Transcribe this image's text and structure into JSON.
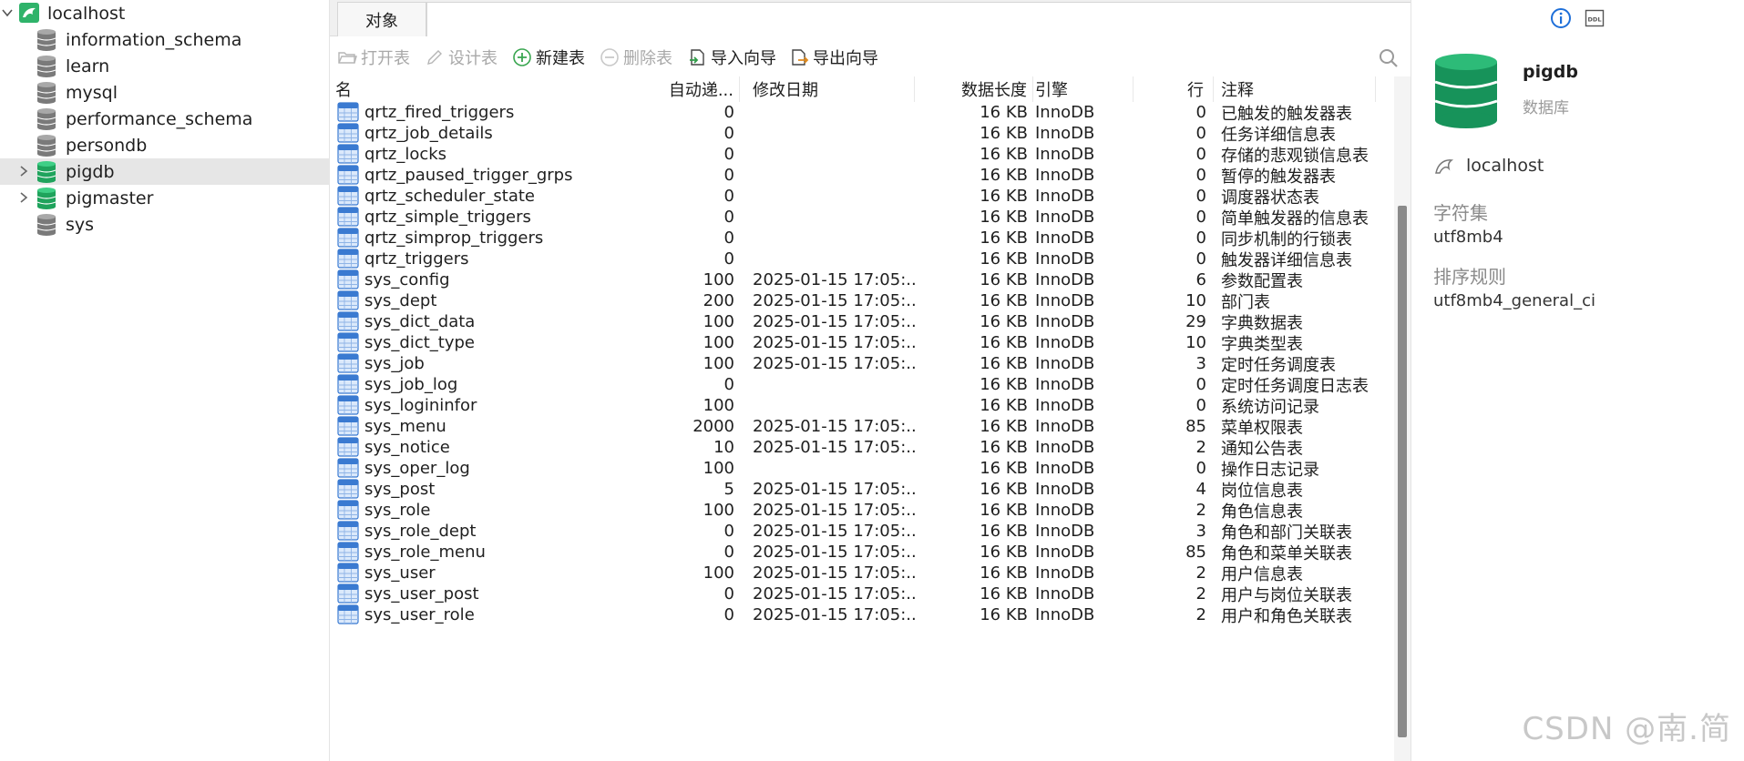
{
  "tree": {
    "connection": "localhost",
    "databases": [
      {
        "name": "information_schema",
        "active": false,
        "expandable": false
      },
      {
        "name": "learn",
        "active": false,
        "expandable": false
      },
      {
        "name": "mysql",
        "active": false,
        "expandable": false
      },
      {
        "name": "performance_schema",
        "active": false,
        "expandable": false
      },
      {
        "name": "persondb",
        "active": false,
        "expandable": false
      },
      {
        "name": "pigdb",
        "active": true,
        "expandable": true,
        "selected": true
      },
      {
        "name": "pigmaster",
        "active": true,
        "expandable": true
      },
      {
        "name": "sys",
        "active": false,
        "expandable": false
      }
    ]
  },
  "tabs": {
    "objects": "对象"
  },
  "toolbar": {
    "open_table": "打开表",
    "design_table": "设计表",
    "new_table": "新建表",
    "delete_table": "删除表",
    "import_wizard": "导入向导",
    "export_wizard": "导出向导"
  },
  "table_headers": {
    "name": "名",
    "auto_increment": "自动递...",
    "modified": "修改日期",
    "data_length": "数据长度",
    "engine": "引擎",
    "rows": "行",
    "comment": "注释"
  },
  "tables": [
    {
      "name": "qrtz_fired_triggers",
      "auto_inc": "0",
      "modified": "",
      "size": "16 KB",
      "engine": "InnoDB",
      "rows": "0",
      "comment": "已触发的触发器表"
    },
    {
      "name": "qrtz_job_details",
      "auto_inc": "0",
      "modified": "",
      "size": "16 KB",
      "engine": "InnoDB",
      "rows": "0",
      "comment": "任务详细信息表"
    },
    {
      "name": "qrtz_locks",
      "auto_inc": "0",
      "modified": "",
      "size": "16 KB",
      "engine": "InnoDB",
      "rows": "0",
      "comment": "存储的悲观锁信息表"
    },
    {
      "name": "qrtz_paused_trigger_grps",
      "auto_inc": "0",
      "modified": "",
      "size": "16 KB",
      "engine": "InnoDB",
      "rows": "0",
      "comment": "暂停的触发器表"
    },
    {
      "name": "qrtz_scheduler_state",
      "auto_inc": "0",
      "modified": "",
      "size": "16 KB",
      "engine": "InnoDB",
      "rows": "0",
      "comment": "调度器状态表"
    },
    {
      "name": "qrtz_simple_triggers",
      "auto_inc": "0",
      "modified": "",
      "size": "16 KB",
      "engine": "InnoDB",
      "rows": "0",
      "comment": "简单触发器的信息表"
    },
    {
      "name": "qrtz_simprop_triggers",
      "auto_inc": "0",
      "modified": "",
      "size": "16 KB",
      "engine": "InnoDB",
      "rows": "0",
      "comment": "同步机制的行锁表"
    },
    {
      "name": "qrtz_triggers",
      "auto_inc": "0",
      "modified": "",
      "size": "16 KB",
      "engine": "InnoDB",
      "rows": "0",
      "comment": "触发器详细信息表"
    },
    {
      "name": "sys_config",
      "auto_inc": "100",
      "modified": "2025-01-15 17:05:...",
      "size": "16 KB",
      "engine": "InnoDB",
      "rows": "6",
      "comment": "参数配置表"
    },
    {
      "name": "sys_dept",
      "auto_inc": "200",
      "modified": "2025-01-15 17:05:...",
      "size": "16 KB",
      "engine": "InnoDB",
      "rows": "10",
      "comment": "部门表"
    },
    {
      "name": "sys_dict_data",
      "auto_inc": "100",
      "modified": "2025-01-15 17:05:...",
      "size": "16 KB",
      "engine": "InnoDB",
      "rows": "29",
      "comment": "字典数据表"
    },
    {
      "name": "sys_dict_type",
      "auto_inc": "100",
      "modified": "2025-01-15 17:05:...",
      "size": "16 KB",
      "engine": "InnoDB",
      "rows": "10",
      "comment": "字典类型表"
    },
    {
      "name": "sys_job",
      "auto_inc": "100",
      "modified": "2025-01-15 17:05:...",
      "size": "16 KB",
      "engine": "InnoDB",
      "rows": "3",
      "comment": "定时任务调度表"
    },
    {
      "name": "sys_job_log",
      "auto_inc": "0",
      "modified": "",
      "size": "16 KB",
      "engine": "InnoDB",
      "rows": "0",
      "comment": "定时任务调度日志表"
    },
    {
      "name": "sys_logininfor",
      "auto_inc": "100",
      "modified": "",
      "size": "16 KB",
      "engine": "InnoDB",
      "rows": "0",
      "comment": "系统访问记录"
    },
    {
      "name": "sys_menu",
      "auto_inc": "2000",
      "modified": "2025-01-15 17:05:...",
      "size": "16 KB",
      "engine": "InnoDB",
      "rows": "85",
      "comment": "菜单权限表"
    },
    {
      "name": "sys_notice",
      "auto_inc": "10",
      "modified": "2025-01-15 17:05:...",
      "size": "16 KB",
      "engine": "InnoDB",
      "rows": "2",
      "comment": "通知公告表"
    },
    {
      "name": "sys_oper_log",
      "auto_inc": "100",
      "modified": "",
      "size": "16 KB",
      "engine": "InnoDB",
      "rows": "0",
      "comment": "操作日志记录"
    },
    {
      "name": "sys_post",
      "auto_inc": "5",
      "modified": "2025-01-15 17:05:...",
      "size": "16 KB",
      "engine": "InnoDB",
      "rows": "4",
      "comment": "岗位信息表"
    },
    {
      "name": "sys_role",
      "auto_inc": "100",
      "modified": "2025-01-15 17:05:...",
      "size": "16 KB",
      "engine": "InnoDB",
      "rows": "2",
      "comment": "角色信息表"
    },
    {
      "name": "sys_role_dept",
      "auto_inc": "0",
      "modified": "2025-01-15 17:05:...",
      "size": "16 KB",
      "engine": "InnoDB",
      "rows": "3",
      "comment": "角色和部门关联表"
    },
    {
      "name": "sys_role_menu",
      "auto_inc": "0",
      "modified": "2025-01-15 17:05:...",
      "size": "16 KB",
      "engine": "InnoDB",
      "rows": "85",
      "comment": "角色和菜单关联表"
    },
    {
      "name": "sys_user",
      "auto_inc": "100",
      "modified": "2025-01-15 17:05:...",
      "size": "16 KB",
      "engine": "InnoDB",
      "rows": "2",
      "comment": "用户信息表"
    },
    {
      "name": "sys_user_post",
      "auto_inc": "0",
      "modified": "2025-01-15 17:05:...",
      "size": "16 KB",
      "engine": "InnoDB",
      "rows": "2",
      "comment": "用户与岗位关联表"
    },
    {
      "name": "sys_user_role",
      "auto_inc": "0",
      "modified": "2025-01-15 17:05:...",
      "size": "16 KB",
      "engine": "InnoDB",
      "rows": "2",
      "comment": "用户和角色关联表"
    }
  ],
  "info_panel": {
    "db_name": "pigdb",
    "db_kind": "数据库",
    "host": "localhost",
    "charset_label": "字符集",
    "charset_value": "utf8mb4",
    "collation_label": "排序规则",
    "collation_value": "utf8mb4_general_ci"
  },
  "watermark": "CSDN @南.简",
  "colors": {
    "active_db": "#1fa35c",
    "inactive_db": "#7a7a7a",
    "table_icon": "#3a7ad1",
    "selection": "#e6e6e6"
  },
  "icons": {
    "connection": "dolphin-connection-icon",
    "database": "database-cylinder-icon",
    "table": "table-grid-icon",
    "info": "info-icon",
    "ddl": "ddl-icon",
    "search": "search-icon"
  }
}
